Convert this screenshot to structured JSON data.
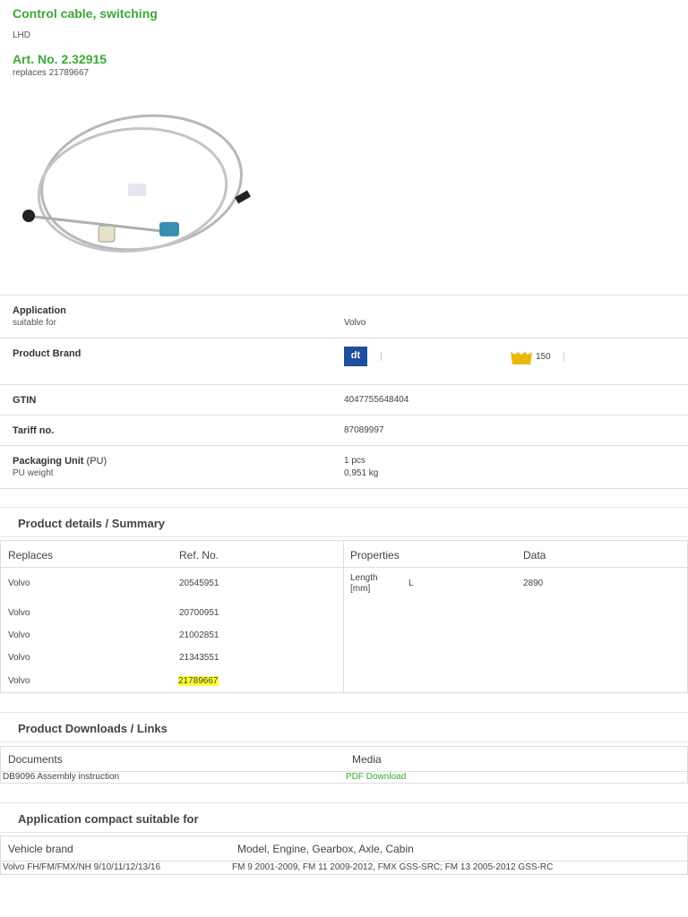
{
  "product": {
    "title": "Control cable, switching",
    "variant": "LHD",
    "art_no": "Art. No. 2.32915",
    "replaces": "replaces 21789667"
  },
  "info": {
    "application_label": "Application",
    "application_sub": "suitable for",
    "application_value": "Volvo",
    "brand_label": "Product Brand",
    "brand_sep1": "|",
    "brand_count": "150",
    "brand_sep2": "|",
    "gtin_label": "GTIN",
    "gtin_value": "4047755648404",
    "tariff_label": "Tariff no.",
    "tariff_value": "87089997",
    "pu_label": "Packaging Unit",
    "pu_abbr": "(PU)",
    "pu_weight_label": "PU weight",
    "pu_value": "1 pcs",
    "pu_weight": "0,951 kg"
  },
  "details": {
    "heading": "Product details / Summary",
    "headers": [
      "Replaces",
      "Ref. No.",
      "Properties",
      "Data"
    ],
    "rows": [
      {
        "brand": "Volvo",
        "ref": "20545951"
      },
      {
        "brand": "Volvo",
        "ref": "20700951"
      },
      {
        "brand": "Volvo",
        "ref": "21002851"
      },
      {
        "brand": "Volvo",
        "ref": "21343551"
      },
      {
        "brand": "Volvo",
        "ref": "21789667"
      }
    ],
    "property": {
      "name": "Length [mm]",
      "symbol": "L",
      "value": "2890"
    }
  },
  "downloads": {
    "heading": "Product Downloads / Links",
    "headers": [
      "Documents",
      "Media"
    ],
    "doc": "DB9096 Assembly instruction",
    "media": "PDF Download"
  },
  "compact": {
    "heading": "Application compact suitable for",
    "headers": [
      "Vehicle brand",
      "Model, Engine, Gearbox, Axle, Cabin"
    ],
    "brand": "Volvo FH/FM/FMX/NH 9/10/11/12/13/16",
    "models": "FM 9 2001-2009, FM 11 2009-2012, FMX GSS-SRC; FM 13 2005-2012 GSS-RC"
  },
  "colors": {
    "accent": "#3aa935",
    "highlight": "#ffff33",
    "crown": "#e8b90c",
    "logo": "#1e4f9c"
  }
}
